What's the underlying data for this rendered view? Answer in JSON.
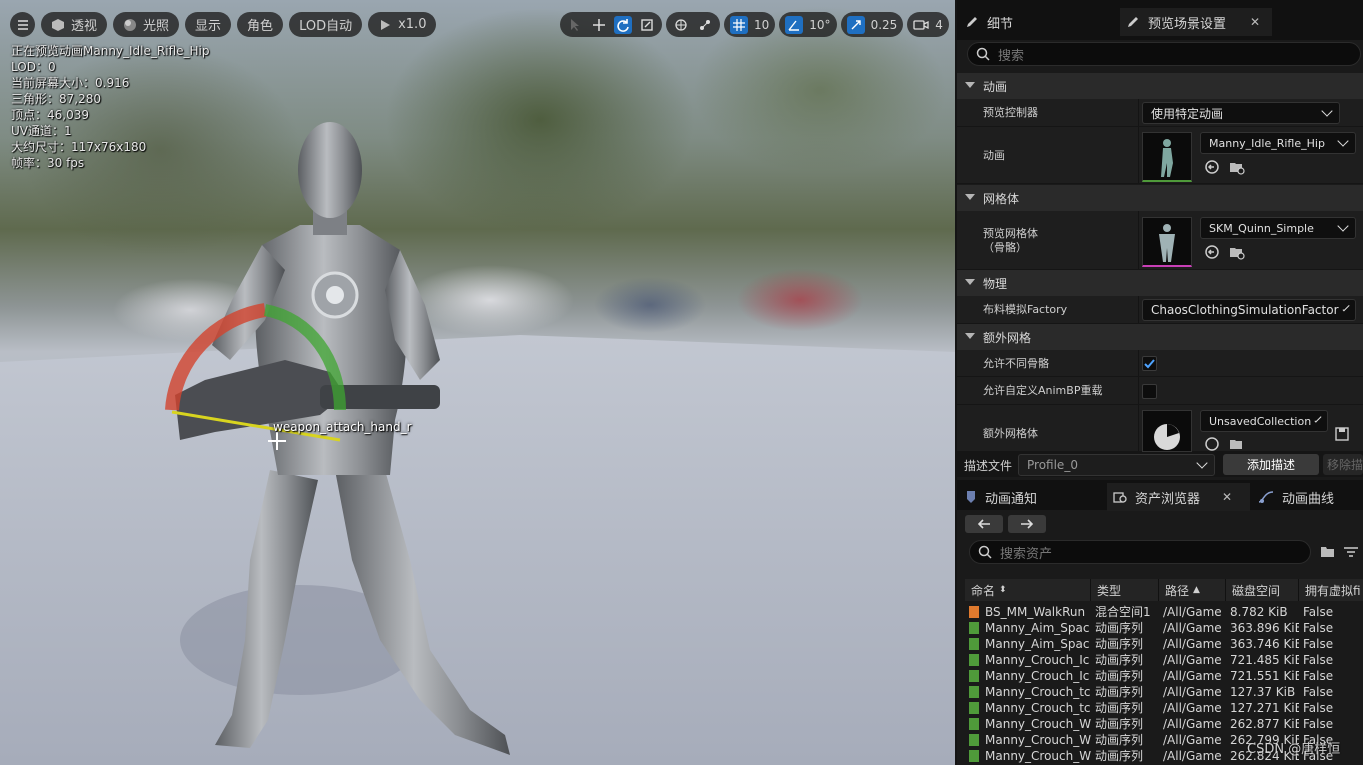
{
  "viewport": {
    "toolbar_left": {
      "perspective_label": "透视",
      "lighting_label": "光照",
      "show_label": "显示",
      "character_label": "角色",
      "lod_label": "LOD自动",
      "play_speed_label": "x1.0"
    },
    "toolbar_right": {
      "grid_snap_value": "10",
      "rotation_snap_value": "10°",
      "scale_snap_value": "0.25",
      "camera_speed_value": "4"
    },
    "stats": {
      "line1": "正在预览动画Manny_Idle_Rifle_Hip",
      "line2": "LOD：0",
      "line3": "当前屏幕大小：0.916",
      "line4": "三角形：87,280",
      "line5": "顶点：46,039",
      "line6": "UV通道：1",
      "line7": "大约尺寸：117x76x180",
      "line8": "帧率：30 fps"
    },
    "bone_label": "weapon_attach_hand_r"
  },
  "right_panel": {
    "tabs": {
      "details_label": "细节",
      "preview_settings_label": "预览场景设置"
    },
    "search_placeholder": "搜索",
    "sections": {
      "animation": "动画",
      "mesh": "网格体",
      "physics": "物理",
      "additional_meshes": "额外网格"
    },
    "properties": {
      "preview_controller_label": "预览控制器",
      "preview_controller_value": "使用特定动画",
      "animation_label": "动画",
      "animation_value": "Manny_Idle_Rifle_Hip",
      "preview_mesh_label_1": "预览网格体",
      "preview_mesh_label_2": "（骨骼）",
      "preview_mesh_value": "SKM_Quinn_Simple",
      "cloth_factory_label": "布料模拟Factory",
      "cloth_factory_value": "ChaosClothingSimulationFactor",
      "allow_diff_skeletons_label": "允许不同骨骼",
      "allow_diff_skeletons_checked": true,
      "allow_custom_animbp_label": "允许自定义AnimBP重载",
      "allow_custom_animbp_checked": false,
      "additional_mesh_label": "额外网格体",
      "additional_mesh_value": "UnsavedCollection"
    },
    "profile": {
      "label": "描述文件",
      "value": "Profile_0",
      "add_button": "添加描述",
      "remove_button": "移除描"
    },
    "bottom_tabs": {
      "anim_notify": "动画通知",
      "asset_browser": "资产浏览器",
      "anim_curves": "动画曲线"
    },
    "asset_search_placeholder": "搜索资产",
    "table": {
      "columns": [
        "命名",
        "类型",
        "路径",
        "磁盘空间",
        "拥有虚拟fi"
      ],
      "rows": [
        {
          "name": "BS_MM_WalkRun",
          "type": "混合空间1",
          "path": "/All/Game",
          "size": "8.782 KiB",
          "virtual": "False",
          "icon_color": "#e07a2e"
        },
        {
          "name": "Manny_Aim_Spac",
          "type": "动画序列",
          "path": "/All/Game",
          "size": "363.896 KiE",
          "virtual": "False",
          "icon_color": "#4f9a3a"
        },
        {
          "name": "Manny_Aim_Spac",
          "type": "动画序列",
          "path": "/All/Game",
          "size": "363.746 KiE",
          "virtual": "False",
          "icon_color": "#4f9a3a"
        },
        {
          "name": "Manny_Crouch_Ic",
          "type": "动画序列",
          "path": "/All/Game",
          "size": "721.485 KiE",
          "virtual": "False",
          "icon_color": "#4f9a3a"
        },
        {
          "name": "Manny_Crouch_Ic",
          "type": "动画序列",
          "path": "/All/Game",
          "size": "721.551 KiE",
          "virtual": "False",
          "icon_color": "#4f9a3a"
        },
        {
          "name": "Manny_Crouch_tc",
          "type": "动画序列",
          "path": "/All/Game",
          "size": "127.37 KiB",
          "virtual": "False",
          "icon_color": "#4f9a3a"
        },
        {
          "name": "Manny_Crouch_tc",
          "type": "动画序列",
          "path": "/All/Game",
          "size": "127.271 KiE",
          "virtual": "False",
          "icon_color": "#4f9a3a"
        },
        {
          "name": "Manny_Crouch_W",
          "type": "动画序列",
          "path": "/All/Game",
          "size": "262.877 KiE",
          "virtual": "False",
          "icon_color": "#4f9a3a"
        },
        {
          "name": "Manny_Crouch_W",
          "type": "动画序列",
          "path": "/All/Game",
          "size": "262.799 KiE",
          "virtual": "False",
          "icon_color": "#4f9a3a"
        },
        {
          "name": "Manny_Crouch_W",
          "type": "动画序列",
          "path": "/All/Game",
          "size": "262.824 KiE",
          "virtual": "False",
          "icon_color": "#4f9a3a"
        }
      ]
    }
  },
  "watermark": "CSDN @唐样恒",
  "colors": {
    "accent": "#1f6fc1",
    "panel_bg": "#1a1a1a",
    "section_bg": "#2a2a2a"
  }
}
